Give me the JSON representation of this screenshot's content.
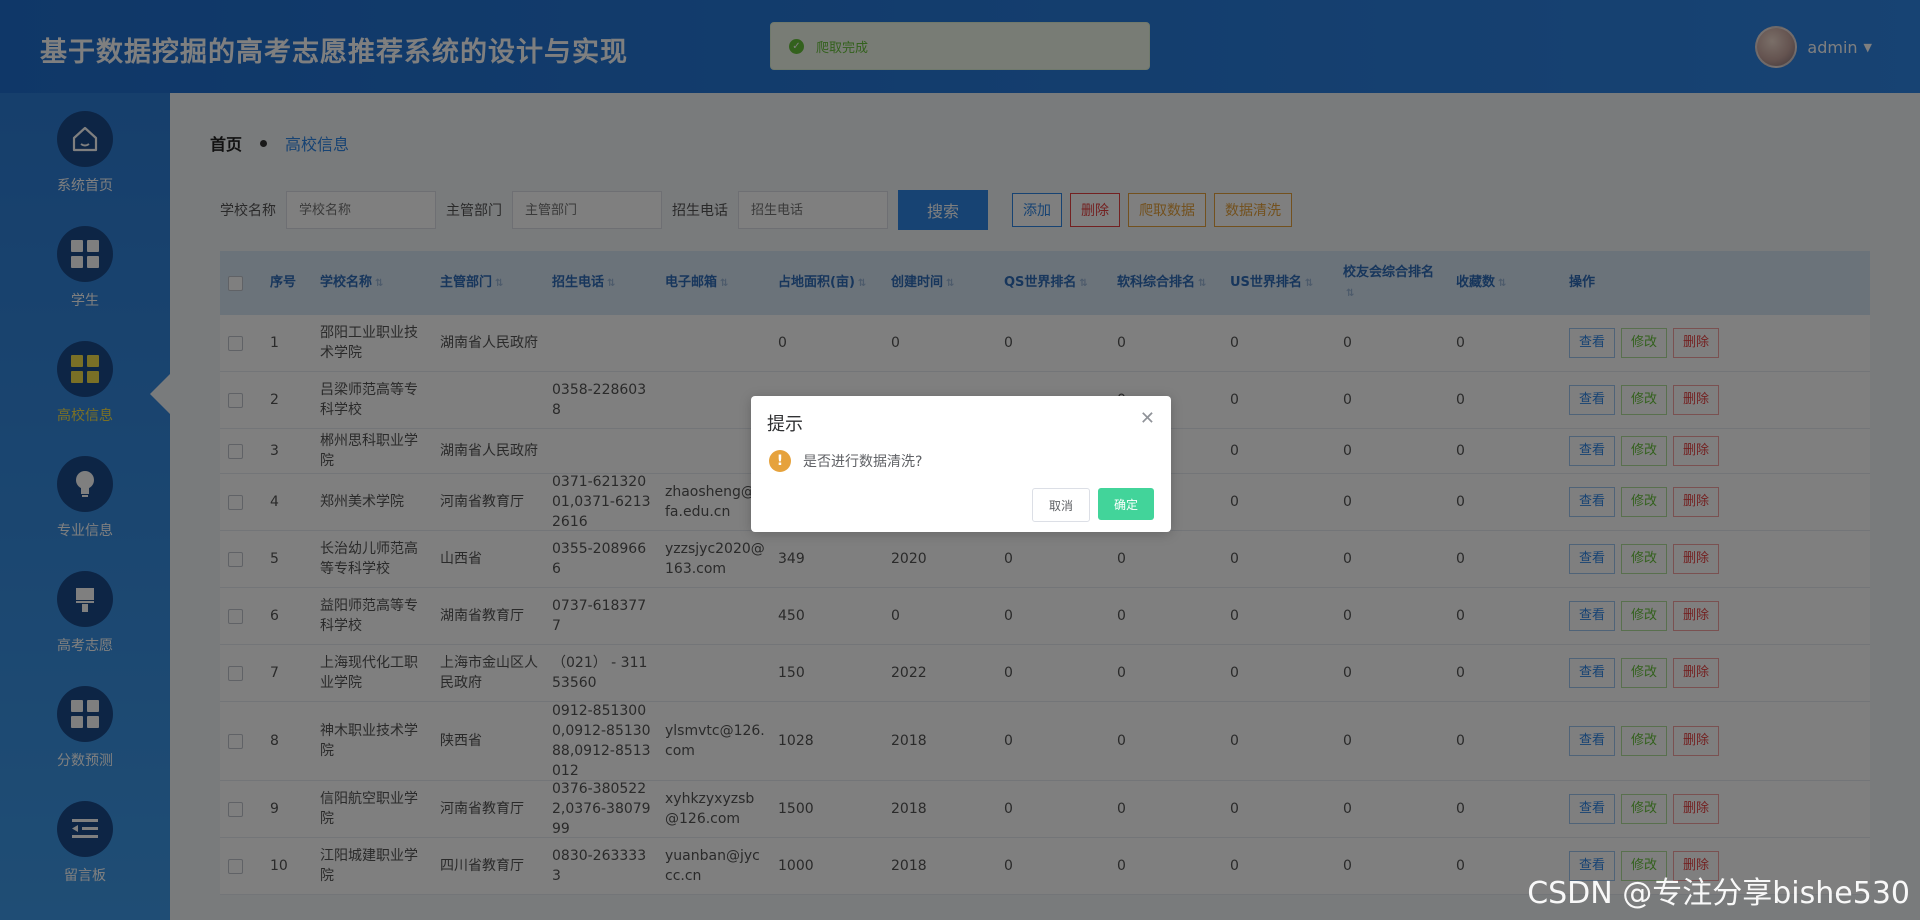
{
  "app": {
    "title": "基于数据挖掘的高考志愿推荐系统的设计与实现"
  },
  "toast": {
    "text": "爬取完成"
  },
  "user": {
    "name": "admin"
  },
  "sidebar": {
    "items": [
      {
        "label": "系统首页",
        "icon": "home-icon"
      },
      {
        "label": "学生",
        "icon": "grid-icon"
      },
      {
        "label": "高校信息",
        "icon": "grid-icon",
        "active": true
      },
      {
        "label": "专业信息",
        "icon": "bulb-icon"
      },
      {
        "label": "高考志愿",
        "icon": "brush-icon"
      },
      {
        "label": "分数预测",
        "icon": "grid-icon"
      },
      {
        "label": "留言板",
        "icon": "list-icon"
      }
    ]
  },
  "breadcrumb": {
    "home": "首页",
    "current": "高校信息"
  },
  "search": {
    "school_label": "学校名称",
    "school_placeholder": "学校名称",
    "dept_label": "主管部门",
    "dept_placeholder": "主管部门",
    "tel_label": "招生电话",
    "tel_placeholder": "招生电话",
    "search_btn": "搜索"
  },
  "toolbar": {
    "add": "添加",
    "delete": "删除",
    "crawl": "爬取数据",
    "clean": "数据清洗"
  },
  "table": {
    "headers": {
      "no": "序号",
      "name": "学校名称",
      "dept": "主管部门",
      "tel": "招生电话",
      "mail": "电子邮箱",
      "area": "占地面积(亩)",
      "date": "创建时间",
      "qs": "QS世界排名",
      "rk": "软科综合排名",
      "us": "US世界排名",
      "alumni": "校友会综合排名",
      "fav": "收藏数",
      "op": "操作"
    },
    "actions": {
      "view": "查看",
      "edit": "修改",
      "delete": "删除"
    },
    "rows": [
      {
        "no": "1",
        "name": "邵阳工业职业技术学院",
        "dept": "湖南省人民政府",
        "tel": "",
        "mail": "",
        "area": "0",
        "date": "0",
        "qs": "0",
        "rk": "0",
        "us": "0",
        "alumni": "0",
        "fav": "0"
      },
      {
        "no": "2",
        "name": "吕梁师范高等专科学校",
        "dept": "",
        "tel": "0358-2286038",
        "mail": "",
        "area": "",
        "date": "",
        "qs": "",
        "rk": "0",
        "us": "0",
        "alumni": "0",
        "fav": "0"
      },
      {
        "no": "3",
        "name": "郴州思科职业学院",
        "dept": "湖南省人民政府",
        "tel": "",
        "mail": "",
        "area": "",
        "date": "",
        "qs": "",
        "rk": "",
        "us": "0",
        "alumni": "0",
        "fav": "0"
      },
      {
        "no": "4",
        "name": "郑州美术学院",
        "dept": "河南省教育厅",
        "tel": "0371-62132001,0371-62132616",
        "mail": "zhaosheng@afa.edu.cn",
        "area": "",
        "date": "",
        "qs": "",
        "rk": "",
        "us": "0",
        "alumni": "0",
        "fav": "0"
      },
      {
        "no": "5",
        "name": "长治幼儿师范高等专科学校",
        "dept": "山西省",
        "tel": "0355-2089666",
        "mail": "yzzsjyc2020@163.com",
        "area": "349",
        "date": "2020",
        "qs": "0",
        "rk": "0",
        "us": "0",
        "alumni": "0",
        "fav": "0"
      },
      {
        "no": "6",
        "name": "益阳师范高等专科学校",
        "dept": "湖南省教育厅",
        "tel": "0737-6183777",
        "mail": "",
        "area": "450",
        "date": "0",
        "qs": "0",
        "rk": "0",
        "us": "0",
        "alumni": "0",
        "fav": "0"
      },
      {
        "no": "7",
        "name": "上海现代化工职业学院",
        "dept": "上海市金山区人民政府",
        "tel": "（021） - 31153560",
        "mail": "",
        "area": "150",
        "date": "2022",
        "qs": "0",
        "rk": "0",
        "us": "0",
        "alumni": "0",
        "fav": "0"
      },
      {
        "no": "8",
        "name": "神木职业技术学院",
        "dept": "陕西省",
        "tel": "0912-8513000,0912-8513088,0912-8513012",
        "mail": "ylsmvtc@126.com",
        "area": "1028",
        "date": "2018",
        "qs": "0",
        "rk": "0",
        "us": "0",
        "alumni": "0",
        "fav": "0"
      },
      {
        "no": "9",
        "name": "信阳航空职业学院",
        "dept": "河南省教育厅",
        "tel": "0376-3805222,0376-3807999",
        "mail": "xyhkzyxyzsb@126.com",
        "area": "1500",
        "date": "2018",
        "qs": "0",
        "rk": "0",
        "us": "0",
        "alumni": "0",
        "fav": "0"
      },
      {
        "no": "10",
        "name": "江阳城建职业学院",
        "dept": "四川省教育厅",
        "tel": "0830-2633333",
        "mail": "yuanban@jyccc.cn",
        "area": "1000",
        "date": "2018",
        "qs": "0",
        "rk": "0",
        "us": "0",
        "alumni": "0",
        "fav": "0"
      }
    ]
  },
  "dialog": {
    "title": "提示",
    "message": "是否进行数据清洗?",
    "cancel": "取消",
    "confirm": "确定"
  },
  "watermark": "CSDN @专注分享bishe530"
}
